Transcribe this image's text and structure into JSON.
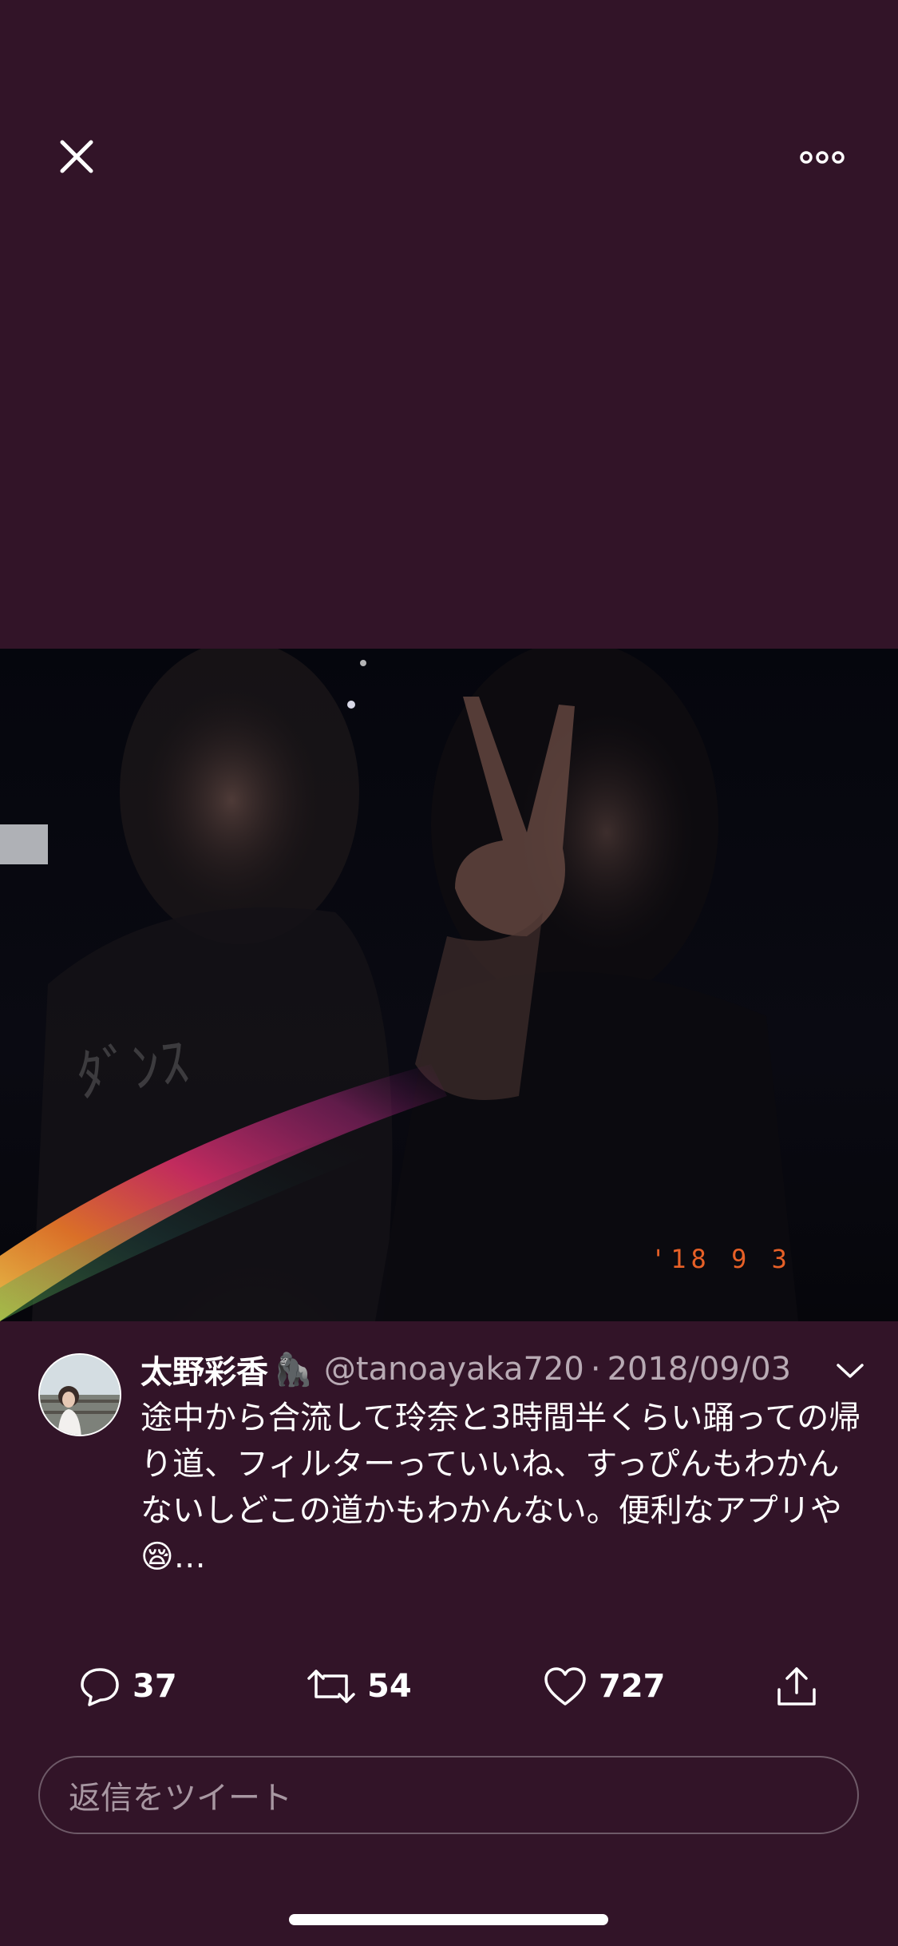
{
  "topbar": {
    "close_icon": "close-icon",
    "more_icon": "more-options-icon"
  },
  "photo": {
    "date_stamp": "'18 9 3"
  },
  "tweet": {
    "display_name": "太野彩香",
    "name_emoji": "🦍",
    "handle": "@tanoayaka720",
    "separator": "·",
    "date": "2018/09/03",
    "text": "途中から合流して玲奈と3時間半くらい踊っての帰り道、フィルターっていいね、すっぴんもわかんないしどこの道かもわかんない。便利なアプリや😪…"
  },
  "actions": {
    "reply_count": "37",
    "retweet_count": "54",
    "like_count": "727"
  },
  "reply_box": {
    "placeholder": "返信をツイート"
  },
  "colors": {
    "background": "#321428",
    "muted_text": "#b8aab4",
    "date_stamp": "#ff6a2a"
  }
}
